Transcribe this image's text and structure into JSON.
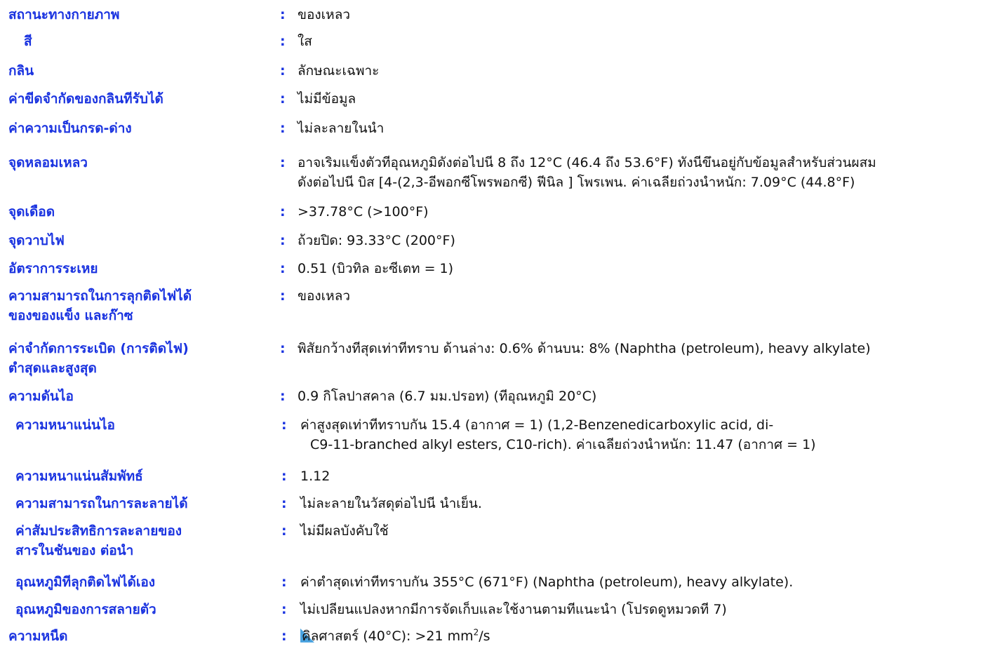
{
  "properties": [
    {
      "label": "สถานะทางกายภาพ",
      "value": [
        "ของเหลว"
      ]
    },
    {
      "label": "สี",
      "value": [
        "ใส"
      ]
    },
    {
      "label": "กลิน",
      "value": [
        "ลักษณะเฉพาะ"
      ]
    },
    {
      "label": "ค่าขีดจํากัดของกลินทีรับได้",
      "value": [
        "ไม่มีข้อมูล"
      ]
    },
    {
      "label": "ค่าความเป็นกรด-ด่าง",
      "value": [
        "ไม่ละลายในนํา"
      ]
    },
    {
      "label": "จุดหลอมเหลว",
      "value": [
        "อาจเริมแข็งตัวทีอุณหภูมิดังต่อไปนี 8 ถึง 12°C (46.4 ถึง 53.6°F) ทังนีขึนอยู่กับข้อมูลสําหรับส่วนผสม",
        "ดังต่อไปนี บิส [4-(2,3-อีพอกซีโพรพอกซี) ฟีนิล ] โพรเพน. ค่าเฉลียถ่วงนําหนัก: 7.09°C (44.8°F)"
      ]
    },
    {
      "label": "จุดเดือด",
      "value": [
        ">37.78°C (>100°F)"
      ]
    },
    {
      "label": "จุดวาบไฟ",
      "value": [
        "ถ้วยปิด: 93.33°C (200°F)"
      ]
    },
    {
      "label": "อัตราการระเหย",
      "value": [
        "0.51 (บิวทิล อะซีเตท = 1)"
      ]
    },
    {
      "label": [
        "ความสามารถในการลุกติดไฟได้",
        "ของของแข็ง และก๊าซ"
      ],
      "value": [
        "ของเหลว"
      ]
    },
    {
      "label": [
        "ค่าจํากัดการระเบิด (การติดไฟ)",
        "ตําสุดและสูงสุด"
      ],
      "value": [
        "พิสัยกว้างทีสุดเท่าทีทราบ ด้านล่าง: 0.6%  ด้านบน: 8% (Naphtha (petroleum), heavy alkylate)"
      ]
    },
    {
      "label": "ความดันไอ",
      "value": [
        "0.9 กิโลปาสคาล (6.7 มม.ปรอท) (ทีอุณหภูมิ 20°C)"
      ]
    },
    {
      "label": "ความหนาแน่นไอ",
      "value": [
        "ค่าสูงสุดเท่าทีทราบกัน 15.4  (อากาศ = 1)  (1,2-Benzenedicarboxylic acid, di-",
        "C9-11-branched alkyl esters, C10-rich).  ค่าเฉลียถ่วงนําหนัก: 11.47  (อากาศ = 1)"
      ]
    },
    {
      "label": "ความหนาแน่นสัมพัทธ์",
      "value": [
        "1.12"
      ]
    },
    {
      "label": "ความสามารถในการละลายได้",
      "value": [
        "ไม่ละลายในวัสดุต่อไปนี นําเย็น."
      ]
    },
    {
      "label": [
        "ค่าสัมประสิทธิการละลายของ",
        "สารในชันของ ต่อนํา"
      ],
      "value": [
        "ไม่มีผลบังคับใช้"
      ]
    },
    {
      "label": "อุณหภูมิทีลุกติดไฟได้เอง",
      "value": [
        "ค่าตําสุดเท่าทีทราบกัน 355°C (671°F) (Naphtha (petroleum), heavy alkylate)."
      ]
    },
    {
      "label": "อุณหภูมิของการสลายตัว",
      "value": [
        "ไม่เปลียนแปลงหากมีการจัดเก็บและใช้งานตามทีแนะนํา (โปรดดูหมวดที 7)"
      ]
    },
    {
      "label": "ความหนืด",
      "value_prefix": "คิ",
      "value_main": "ลศาสตร์ (40°C): >21 mm",
      "value_sup": "2",
      "value_suffix": "/s"
    }
  ],
  "colon": ":",
  "colors": {
    "label": "#1a33e0",
    "text": "#111111",
    "marker": "#4aa3e0"
  }
}
